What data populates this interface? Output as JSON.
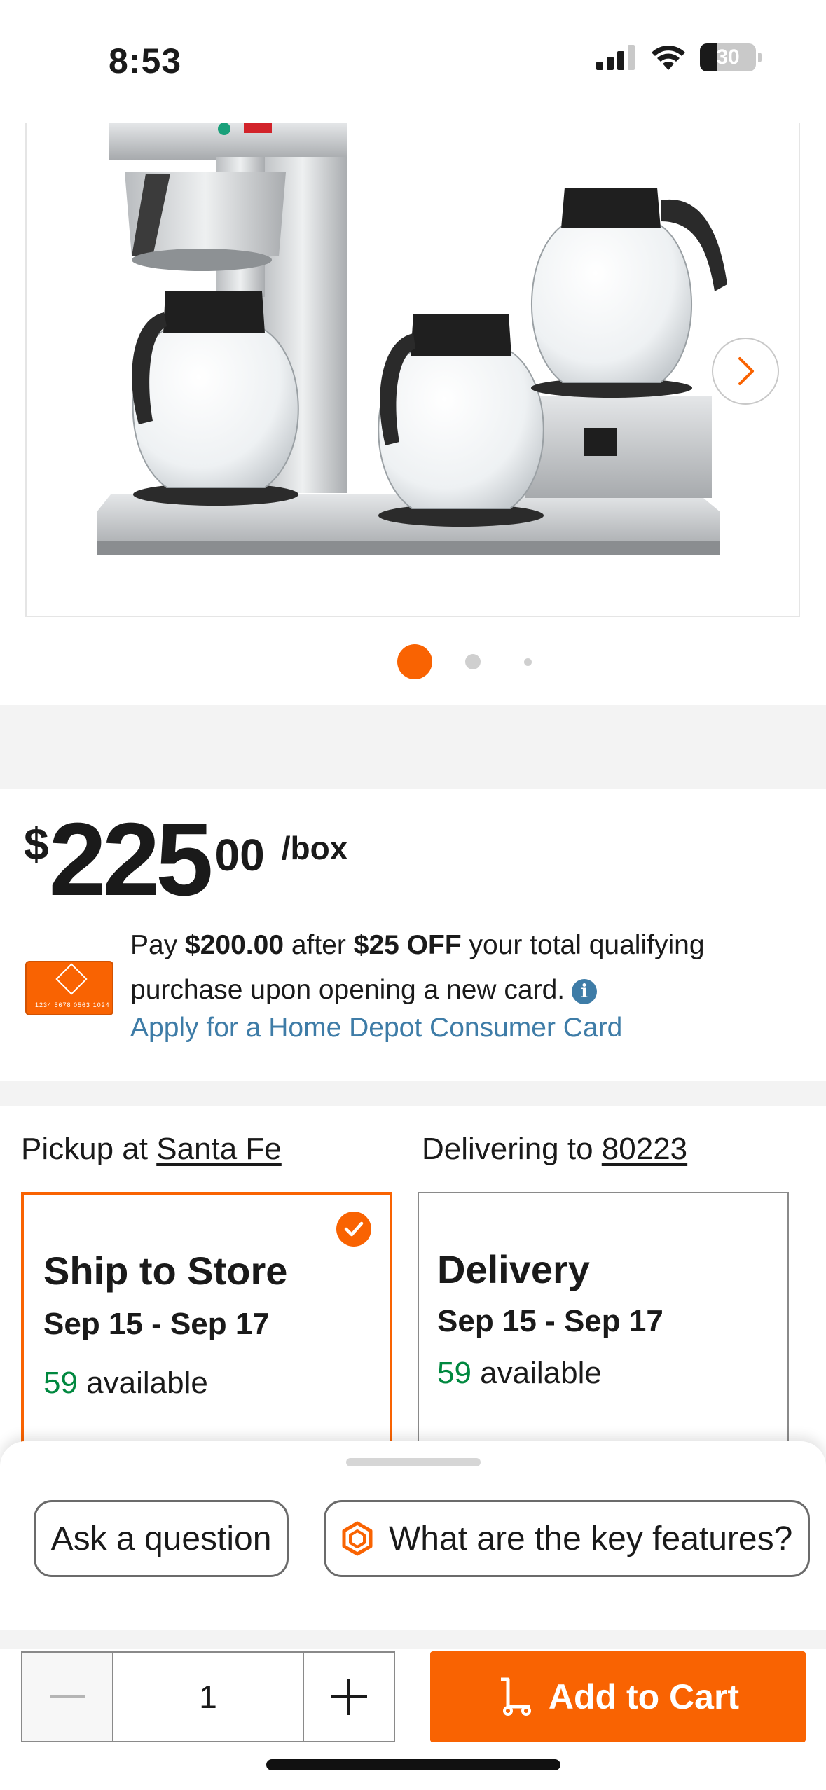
{
  "status_bar": {
    "time": "8:53",
    "battery": "30",
    "battery_level": 0.3
  },
  "gallery": {
    "image_alt": "Commercial coffee maker with three glass carafes",
    "slide_count": 3,
    "active_slide": 1
  },
  "price": {
    "currency": "$",
    "dollars": "225",
    "cents": "00",
    "unit": "/box"
  },
  "promo": {
    "text_1": "Pay ",
    "amount": "$200.00",
    "text_2": " after ",
    "discount": "$25 OFF",
    "text_3": " your total qualifying purchase upon opening a new card.",
    "card_number": "1234 5678 0563 1024",
    "apply_link": "Apply for a Home Depot Consumer Card"
  },
  "fulfillment": {
    "pickup_prefix": "Pickup at ",
    "pickup_store": "Santa Fe",
    "delivery_prefix": "Delivering to ",
    "delivery_zip": "80223",
    "ship_to_store": {
      "title": "Ship to Store",
      "date": "Sep 15 - Sep 17",
      "count": "59",
      "available": " available"
    },
    "delivery": {
      "title": "Delivery",
      "date": "Sep 15 - Sep 17",
      "count": "59",
      "available": " available"
    }
  },
  "assistant": {
    "ask_label": "Ask a question",
    "key_features_label": "What are the key features?"
  },
  "cart": {
    "quantity": "1",
    "add_label": "Add to Cart"
  },
  "colors": {
    "brand": "#f96302",
    "link": "#3e7ca7",
    "available": "#00883f"
  }
}
